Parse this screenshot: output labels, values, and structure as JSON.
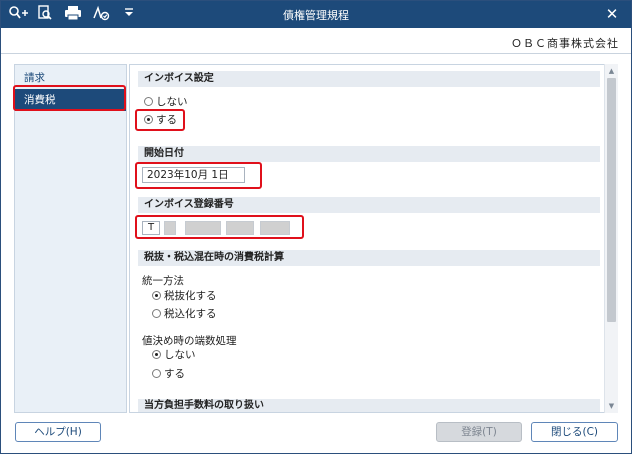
{
  "window": {
    "title": "債権管理規程"
  },
  "toolbar": {
    "icons": [
      "search-add-icon",
      "preview-search-icon",
      "print-icon",
      "export-icon",
      "dropdown-arrow-icon"
    ]
  },
  "header": {
    "company": "ＯＢＣ商事株式会社"
  },
  "sidebar": {
    "items": [
      {
        "label": "請求",
        "active": false
      },
      {
        "label": "消費税",
        "active": true
      }
    ]
  },
  "main": {
    "invoice": {
      "header": "インボイス設定",
      "options": [
        "しない",
        "する"
      ],
      "selected": "する"
    },
    "start_date": {
      "header": "開始日付",
      "value": "2023年10月  1日"
    },
    "registration": {
      "header": "インボイス登録番号",
      "prefix": "T"
    },
    "tax_calc": {
      "header": "税抜・税込混在時の消費税計算",
      "unify_label": "統一方法",
      "unify_options": [
        "税抜化する",
        "税込化する"
      ],
      "unify_selected": "税抜化する",
      "rounding_label": "値決め時の端数処理",
      "rounding_options": [
        "しない",
        "する"
      ],
      "rounding_selected": "しない"
    },
    "fee": {
      "header": "当方負担手数料の取り扱い"
    }
  },
  "footer": {
    "help_label": "ヘルプ(H)",
    "register_label": "登録(T)",
    "close_label": "閉じる(C)"
  },
  "colors": {
    "titlebar": "#1d4a7a",
    "highlight": "#e0101b",
    "section_bg": "#e6ebf1",
    "sidebar_bg": "#e9f0f7"
  }
}
